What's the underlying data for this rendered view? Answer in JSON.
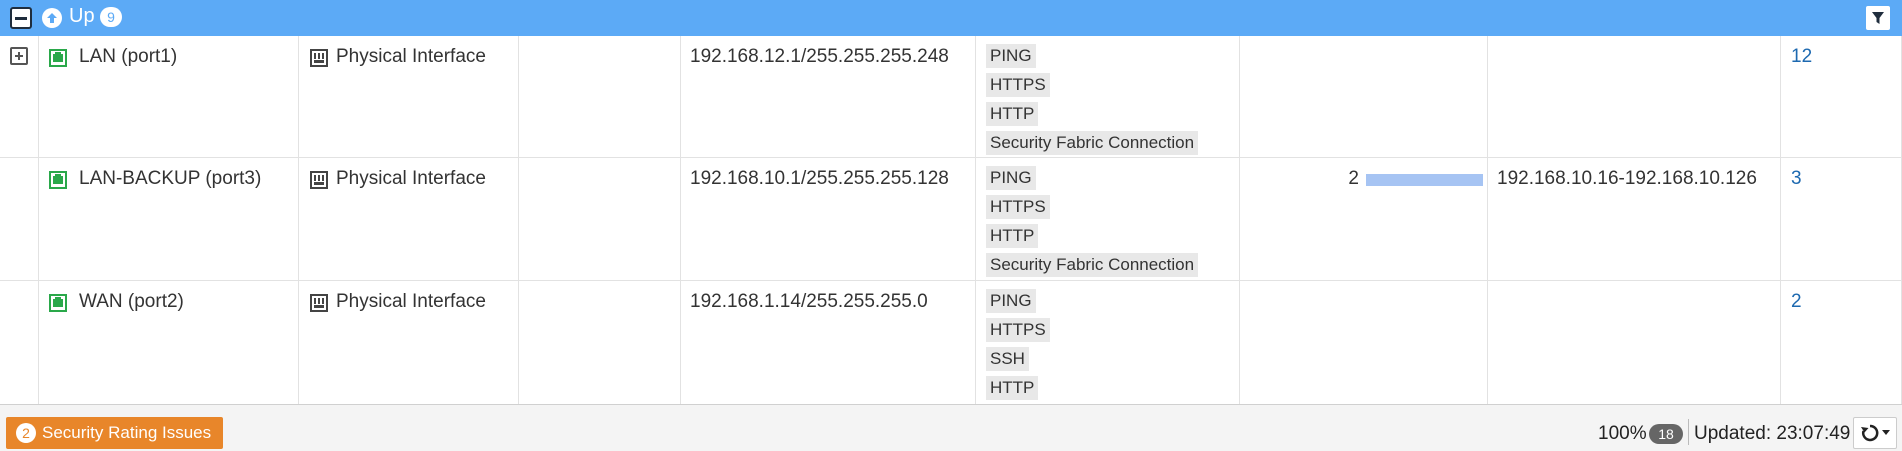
{
  "group": {
    "title": "Up",
    "count": "9"
  },
  "rows": [
    {
      "name": "LAN (port1)",
      "type": "Physical Interface",
      "ip": "192.168.12.1/255.255.255.248",
      "access": [
        "PING",
        "HTTPS",
        "HTTP",
        "Security Fabric Connection"
      ],
      "dhcp_clients": "",
      "dhcp_range": "",
      "ref": "12",
      "expandable": true
    },
    {
      "name": "LAN-BACKUP (port3)",
      "type": "Physical Interface",
      "ip": "192.168.10.1/255.255.255.128",
      "access": [
        "PING",
        "HTTPS",
        "HTTP",
        "Security Fabric Connection"
      ],
      "dhcp_clients": "2",
      "dhcp_usage_fraction": 1.0,
      "dhcp_range": "192.168.10.16-192.168.10.126",
      "ref": "3",
      "expandable": false
    },
    {
      "name": "WAN (port2)",
      "type": "Physical Interface",
      "ip": "192.168.1.14/255.255.255.0",
      "access": [
        "PING",
        "HTTPS",
        "SSH",
        "HTTP"
      ],
      "dhcp_clients": "",
      "dhcp_range": "",
      "ref": "2",
      "expandable": false
    }
  ],
  "footer": {
    "security_count": "2",
    "security_label": "Security Rating Issues",
    "zoom": "100%",
    "zoom_count": "18",
    "updated": "Updated: 23:07:49"
  },
  "colors": {
    "header_bg": "#5caaf6",
    "link": "#1d69b0",
    "warning": "#e8862a",
    "dhcp_bar": "#a6c4f3",
    "port_icon": "#2aa84a"
  }
}
